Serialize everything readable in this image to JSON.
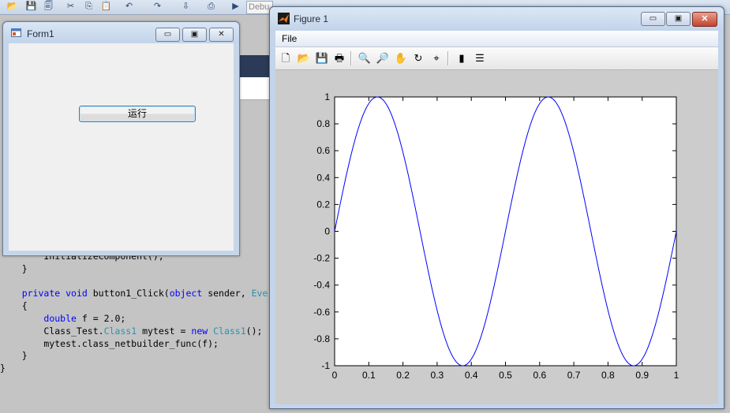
{
  "vs": {
    "debug_config": "Debu",
    "code_lines": [
      "        InitializeComponent();",
      "    }",
      "",
      "    private void button1_Click(object sender, Eve",
      "    {",
      "        double f = 2.0;",
      "        Class_Test.Class1 mytest = new Class1();",
      "        mytest.class_netbuilder_func(f);",
      "    }",
      "}"
    ]
  },
  "form1": {
    "title": "Form1",
    "run_button_label": "运行",
    "min_glyph": "▭",
    "max_glyph": "▣",
    "close_glyph": "✕"
  },
  "figure": {
    "title": "Figure 1",
    "menu_file": "File",
    "min_glyph": "▭",
    "max_glyph": "▣",
    "close_glyph": "✕",
    "toolbar": [
      {
        "name": "new-figure-icon",
        "glyph": "🗋"
      },
      {
        "name": "open-file-icon",
        "glyph": "📂"
      },
      {
        "name": "save-icon",
        "glyph": "💾"
      },
      {
        "name": "print-icon",
        "glyph": "🖶"
      },
      {
        "name": "zoom-in-icon",
        "glyph": "🔍"
      },
      {
        "name": "zoom-out-icon",
        "glyph": "🔎"
      },
      {
        "name": "pan-icon",
        "glyph": "✋"
      },
      {
        "name": "rotate-3d-icon",
        "glyph": "↻"
      },
      {
        "name": "data-cursor-icon",
        "glyph": "⌖"
      },
      {
        "name": "colorbar-icon",
        "glyph": "▮"
      },
      {
        "name": "legend-icon",
        "glyph": "☰"
      }
    ]
  },
  "colors": {
    "line": "#0000ff",
    "axes_bg": "#ffffff",
    "figure_bg": "#cccccc"
  },
  "chart_data": {
    "type": "line",
    "title": "",
    "xlabel": "",
    "ylabel": "",
    "xlim": [
      0,
      1
    ],
    "ylim": [
      -1,
      1
    ],
    "xticks": [
      "0",
      "0.1",
      "0.2",
      "0.3",
      "0.4",
      "0.5",
      "0.6",
      "0.7",
      "0.8",
      "0.9",
      "1"
    ],
    "yticks": [
      "1",
      "0.8",
      "0.6",
      "0.4",
      "0.2",
      "0",
      "-0.2",
      "-0.4",
      "-0.6",
      "-0.8",
      "-1"
    ],
    "grid": false,
    "series": [
      {
        "function": "sin(2*pi*f*x), f = 2",
        "x": [
          0,
          0.025,
          0.05,
          0.075,
          0.1,
          0.125,
          0.15,
          0.175,
          0.2,
          0.225,
          0.25,
          0.275,
          0.3,
          0.325,
          0.35,
          0.375,
          0.4,
          0.425,
          0.45,
          0.475,
          0.5,
          0.525,
          0.55,
          0.575,
          0.6,
          0.625,
          0.65,
          0.675,
          0.7,
          0.725,
          0.75,
          0.775,
          0.8,
          0.825,
          0.85,
          0.875,
          0.9,
          0.925,
          0.95,
          0.975,
          1
        ],
        "y": [
          0,
          0.309,
          0.588,
          0.809,
          0.951,
          1,
          0.951,
          0.809,
          0.588,
          0.309,
          0,
          -0.309,
          -0.588,
          -0.809,
          -0.951,
          -1,
          -0.951,
          -0.809,
          -0.588,
          -0.309,
          0,
          0.309,
          0.588,
          0.809,
          0.951,
          1,
          0.951,
          0.809,
          0.588,
          0.309,
          0,
          -0.309,
          -0.588,
          -0.809,
          -0.951,
          -1,
          -0.951,
          -0.809,
          -0.588,
          -0.309,
          0
        ]
      }
    ]
  }
}
